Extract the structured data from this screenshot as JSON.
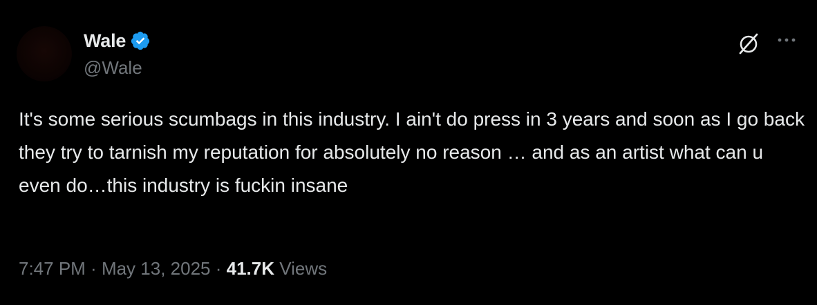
{
  "author": {
    "display_name": "Wale",
    "handle": "@Wale",
    "verified_icon": "verified-badge-icon",
    "verified_color": "#1d9bf0"
  },
  "tweet": {
    "text": "It's some serious scumbags in this industry. I ain't do press in 3 years and soon as I go back they try to tarnish my reputation for absolutely no reason … and as an artist what can u even do…this industry is fuckin insane"
  },
  "meta": {
    "time": "7:47 PM",
    "separator": " · ",
    "date": "May 13, 2025",
    "views_count": "41.7K",
    "views_label": " Views"
  },
  "icons": {
    "grok": "grok-icon",
    "more": "more-options-icon"
  },
  "colors": {
    "background": "#000000",
    "primary_text": "#e7e9ea",
    "secondary_text": "#71767b"
  }
}
